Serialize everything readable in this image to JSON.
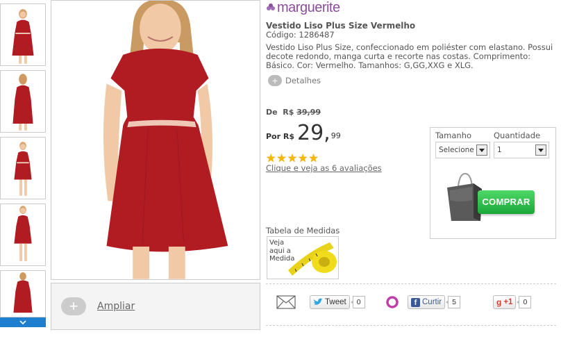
{
  "gallery": {
    "thumbnail_count": 5,
    "zoom_label": "Ampliar",
    "icons": {
      "zoom": "plus-icon",
      "scroll": "chevron-down-icon"
    }
  },
  "product": {
    "brand": "marguerite",
    "title": "Vestido Liso Plus Size Vermelho",
    "code": "Código: 1286487",
    "description": "Vestido Liso Plus Size, confeccionado em poliéster com elastano. Possui decote redondo, manga curta e recorte nas costas. Comprimento: Básico. Cor: Vermelho. Tamanhos: G,GG,XXG e XLG.",
    "details_label": "Detalhes",
    "dress_color": "#b01c22"
  },
  "pricing": {
    "old_prefix": "De",
    "old_currency": "R$",
    "old_value": "39,99",
    "now_prefix": "Por R$",
    "now_integer": "29,",
    "now_cents": "99",
    "rating": 5,
    "rating_max": 5,
    "reviews_link": "Clique e veja as 6 avaliações"
  },
  "buy": {
    "size_label": "Tamanho",
    "size_value": "Selecione",
    "qty_label": "Quantidade",
    "qty_value": "1",
    "button_label": "COMPRAR",
    "button_color": "#1eb43e"
  },
  "measures": {
    "label": "Tabela de Medidas",
    "image_text": [
      "Veja",
      "aqui a",
      "Medida"
    ]
  },
  "share": {
    "tweet_label": "Tweet",
    "tweet_count": "0",
    "facebook_label": "Curtir",
    "facebook_count": "5",
    "gplus_label": "+1",
    "gplus_count": "0"
  }
}
